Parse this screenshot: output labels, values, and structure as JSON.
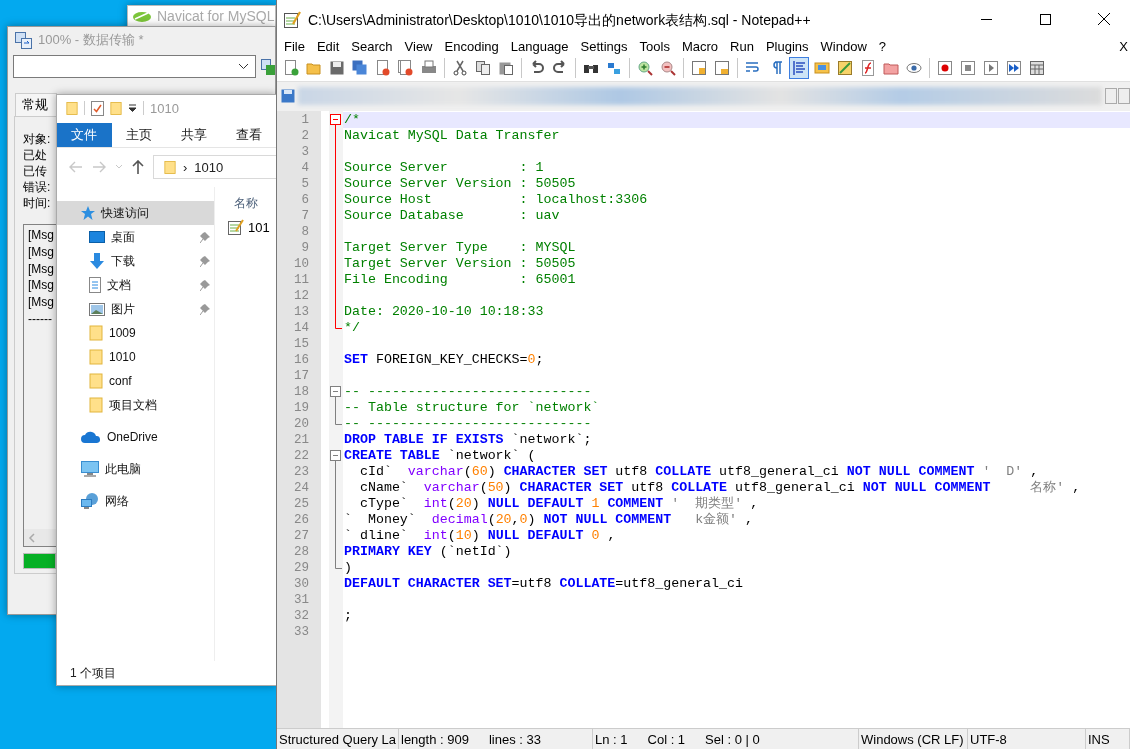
{
  "navicat_window": {
    "title": "Navicat for MySQL"
  },
  "transfer_window": {
    "title": "100% - 数据传输 *",
    "tab": "常规",
    "labels": [
      "对象:",
      "已处",
      "已传",
      "错误:",
      "时间:"
    ],
    "log": [
      "[Msg",
      "[Msg",
      "[Msg",
      "[Msg",
      "[Msg",
      "------"
    ],
    "progress": {
      "level": 1
    }
  },
  "explorer_window": {
    "title": "1010",
    "ribbon_tabs": [
      {
        "label": "文件",
        "selected": true
      },
      {
        "label": "主页",
        "selected": false
      },
      {
        "label": "共享",
        "selected": false
      },
      {
        "label": "查看",
        "selected": false
      }
    ],
    "address": {
      "separator": "›",
      "path": "1010"
    },
    "nav": [
      {
        "label": "快速访问",
        "kind": "star",
        "selected": true,
        "children": [
          {
            "label": "桌面",
            "kind": "desktop",
            "pinned": true
          },
          {
            "label": "下载",
            "kind": "download",
            "pinned": true
          },
          {
            "label": "文档",
            "kind": "document",
            "pinned": true
          },
          {
            "label": "图片",
            "kind": "image",
            "pinned": true
          },
          {
            "label": "1009",
            "kind": "folder",
            "pinned": false
          },
          {
            "label": "1010",
            "kind": "folder",
            "pinned": false
          },
          {
            "label": "conf",
            "kind": "folder",
            "pinned": false
          },
          {
            "label": "项目文档",
            "kind": "folder",
            "pinned": false
          }
        ]
      },
      {
        "label": "OneDrive",
        "kind": "cloud",
        "selected": false
      },
      {
        "label": "此电脑",
        "kind": "computer",
        "selected": false
      },
      {
        "label": "网络",
        "kind": "network",
        "selected": false
      }
    ],
    "column": "名称",
    "files": [
      {
        "name": "101"
      }
    ],
    "status": "1 个项目"
  },
  "notepad_window": {
    "title": "C:\\Users\\Administrator\\Desktop\\1010\\1010导出的network表结构.sql - Notepad++",
    "menu": [
      "File",
      "Edit",
      "Search",
      "View",
      "Encoding",
      "Language",
      "Settings",
      "Tools",
      "Macro",
      "Run",
      "Plugins",
      "Window",
      "?"
    ],
    "doc_close": "X",
    "toolbar": [
      [
        {
          "kind": "new",
          "pressed": false
        },
        {
          "kind": "open",
          "pressed": false
        },
        {
          "kind": "save",
          "pressed": false
        },
        {
          "kind": "saveall",
          "pressed": false
        },
        {
          "kind": "close",
          "pressed": false
        },
        {
          "kind": "closeall",
          "pressed": false
        },
        {
          "kind": "print",
          "pressed": false
        }
      ],
      [
        {
          "kind": "cut",
          "pressed": false
        },
        {
          "kind": "copy",
          "pressed": false
        },
        {
          "kind": "paste",
          "pressed": false
        }
      ],
      [
        {
          "kind": "undo",
          "pressed": false
        },
        {
          "kind": "redo",
          "pressed": false
        }
      ],
      [
        {
          "kind": "find",
          "pressed": false
        },
        {
          "kind": "replace",
          "pressed": false
        }
      ],
      [
        {
          "kind": "zoomin",
          "pressed": false
        },
        {
          "kind": "zoomout",
          "pressed": false
        }
      ],
      [
        {
          "kind": "syncv",
          "pressed": false
        },
        {
          "kind": "synch",
          "pressed": false
        }
      ],
      [
        {
          "kind": "wrap",
          "pressed": false
        },
        {
          "kind": "chars",
          "pressed": false
        },
        {
          "kind": "indent",
          "pressed": true
        },
        {
          "kind": "udl",
          "pressed": false
        },
        {
          "kind": "docmap",
          "pressed": false
        },
        {
          "kind": "funclist",
          "pressed": false
        },
        {
          "kind": "workspace",
          "pressed": false
        },
        {
          "kind": "monitor",
          "pressed": false
        }
      ],
      [
        {
          "kind": "record",
          "pressed": false
        },
        {
          "kind": "stop",
          "pressed": false
        },
        {
          "kind": "play",
          "pressed": false
        },
        {
          "kind": "playmulti",
          "pressed": false
        },
        {
          "kind": "savemacro",
          "pressed": false
        }
      ]
    ],
    "code_lines": [
      {
        "number": "1",
        "current": true,
        "fold_start": true,
        "fold_end": false,
        "tokens": [
          {
            "kind": "comment",
            "text": "/*"
          }
        ]
      },
      {
        "number": "2",
        "current": false,
        "fold_start": false,
        "fold_end": false,
        "tokens": [
          {
            "kind": "comment",
            "text": "Navicat MySQL Data Transfer"
          }
        ]
      },
      {
        "number": "3",
        "current": false,
        "fold_start": false,
        "fold_end": false
      },
      {
        "number": "4",
        "current": false,
        "fold_start": false,
        "fold_end": false,
        "tokens": [
          {
            "kind": "comment",
            "text": "Source Server         : 1"
          }
        ]
      },
      {
        "number": "5",
        "current": false,
        "fold_start": false,
        "fold_end": false,
        "tokens": [
          {
            "kind": "comment",
            "text": "Source Server Version : 50505"
          }
        ]
      },
      {
        "number": "6",
        "current": false,
        "fold_start": false,
        "fold_end": false,
        "tokens": [
          {
            "kind": "comment",
            "text": "Source Host           : localhost:3306"
          }
        ]
      },
      {
        "number": "7",
        "current": false,
        "fold_start": false,
        "fold_end": false,
        "tokens": [
          {
            "kind": "comment",
            "text": "Source Database       : uav"
          }
        ]
      },
      {
        "number": "8",
        "current": false,
        "fold_start": false,
        "fold_end": false
      },
      {
        "number": "9",
        "current": false,
        "fold_start": false,
        "fold_end": false,
        "tokens": [
          {
            "kind": "comment",
            "text": "Target Server Type    : MYSQL"
          }
        ]
      },
      {
        "number": "10",
        "current": false,
        "fold_start": false,
        "fold_end": false,
        "tokens": [
          {
            "kind": "comment",
            "text": "Target Server Version : 50505"
          }
        ]
      },
      {
        "number": "11",
        "current": false,
        "fold_start": false,
        "fold_end": false,
        "tokens": [
          {
            "kind": "comment",
            "text": "File Encoding         : 65001"
          }
        ]
      },
      {
        "number": "12",
        "current": false,
        "fold_start": false,
        "fold_end": false
      },
      {
        "number": "13",
        "current": false,
        "fold_start": false,
        "fold_end": false,
        "tokens": [
          {
            "kind": "comment",
            "text": "Date: 2020-10-10 10:18:33"
          }
        ]
      },
      {
        "number": "14",
        "current": false,
        "fold_start": false,
        "fold_end": true,
        "tokens": [
          {
            "kind": "comment",
            "text": "*/"
          }
        ]
      },
      {
        "number": "15",
        "current": false,
        "fold_start": false,
        "fold_end": false
      },
      {
        "number": "16",
        "current": false,
        "fold_start": false,
        "fold_end": false,
        "tokens": [
          {
            "kind": "keyword",
            "text": "SET"
          },
          {
            "kind": "plain",
            "text": " FOREIGN_KEY_CHECKS="
          },
          {
            "kind": "number",
            "text": "0"
          },
          {
            "kind": "plain",
            "text": ";"
          }
        ]
      },
      {
        "number": "17",
        "current": false,
        "fold_start": false,
        "fold_end": false
      },
      {
        "number": "18",
        "current": false,
        "fold_start": true,
        "fold_end": false,
        "tokens": [
          {
            "kind": "comment",
            "text": "-- ----------------------------"
          }
        ]
      },
      {
        "number": "19",
        "current": false,
        "fold_start": false,
        "fold_end": false,
        "tokens": [
          {
            "kind": "comment",
            "text": "-- Table structure for `network`"
          }
        ]
      },
      {
        "number": "20",
        "current": false,
        "fold_start": false,
        "fold_end": true,
        "tokens": [
          {
            "kind": "comment",
            "text": "-- ----------------------------"
          }
        ]
      },
      {
        "number": "21",
        "current": false,
        "fold_start": false,
        "fold_end": false,
        "tokens": [
          {
            "kind": "keyword",
            "text": "DROP TABLE IF EXISTS"
          },
          {
            "kind": "plain",
            "text": " `network`;"
          }
        ]
      },
      {
        "number": "22",
        "current": false,
        "fold_start": true,
        "fold_end": false,
        "tokens": [
          {
            "kind": "keyword",
            "text": "CREATE TABLE"
          },
          {
            "kind": "plain",
            "text": " `network` ("
          }
        ]
      },
      {
        "number": "23",
        "current": false,
        "fold_start": false,
        "fold_end": false,
        "tokens": [
          {
            "kind": "plain",
            "text": "  cId`  "
          },
          {
            "kind": "type",
            "text": "varchar"
          },
          {
            "kind": "plain",
            "text": "("
          },
          {
            "kind": "number",
            "text": "60"
          },
          {
            "kind": "plain",
            "text": ") "
          },
          {
            "kind": "keyword",
            "text": "CHARACTER SET"
          },
          {
            "kind": "plain",
            "text": " utf8 "
          },
          {
            "kind": "keyword",
            "text": "COLLATE"
          },
          {
            "kind": "plain",
            "text": " utf8_general_ci "
          },
          {
            "kind": "keyword",
            "text": "NOT NULL COMMENT"
          },
          {
            "kind": "string",
            "text": " '  D'"
          },
          {
            "kind": "plain",
            "text": " ,"
          }
        ]
      },
      {
        "number": "24",
        "current": false,
        "fold_start": false,
        "fold_end": false,
        "tokens": [
          {
            "kind": "plain",
            "text": "  cName`  "
          },
          {
            "kind": "type",
            "text": "varchar"
          },
          {
            "kind": "plain",
            "text": "("
          },
          {
            "kind": "number",
            "text": "50"
          },
          {
            "kind": "plain",
            "text": ") "
          },
          {
            "kind": "keyword",
            "text": "CHARACTER SET"
          },
          {
            "kind": "plain",
            "text": " utf8 "
          },
          {
            "kind": "keyword",
            "text": "COLLATE"
          },
          {
            "kind": "plain",
            "text": " utf8_general_ci "
          },
          {
            "kind": "keyword",
            "text": "NOT NULL COMMENT"
          },
          {
            "kind": "string",
            "text": "     名称'"
          },
          {
            "kind": "plain",
            "text": " ,"
          }
        ]
      },
      {
        "number": "25",
        "current": false,
        "fold_start": false,
        "fold_end": false,
        "tokens": [
          {
            "kind": "plain",
            "text": "  cType`  "
          },
          {
            "kind": "type",
            "text": "int"
          },
          {
            "kind": "plain",
            "text": "("
          },
          {
            "kind": "number",
            "text": "20"
          },
          {
            "kind": "plain",
            "text": ") "
          },
          {
            "kind": "keyword",
            "text": "NULL DEFAULT"
          },
          {
            "kind": "number",
            "text": " 1 "
          },
          {
            "kind": "keyword",
            "text": "COMMENT"
          },
          {
            "kind": "string",
            "text": " '  期类型'"
          },
          {
            "kind": "plain",
            "text": " ,"
          }
        ]
      },
      {
        "number": "26",
        "current": false,
        "fold_start": false,
        "fold_end": false,
        "tokens": [
          {
            "kind": "plain",
            "text": "`  Money`  "
          },
          {
            "kind": "type",
            "text": "decimal"
          },
          {
            "kind": "plain",
            "text": "("
          },
          {
            "kind": "number",
            "text": "20"
          },
          {
            "kind": "plain",
            "text": ","
          },
          {
            "kind": "number",
            "text": "0"
          },
          {
            "kind": "plain",
            "text": ") "
          },
          {
            "kind": "keyword",
            "text": "NOT NULL COMMENT"
          },
          {
            "kind": "string",
            "text": "   k金额'"
          },
          {
            "kind": "plain",
            "text": " ,"
          }
        ]
      },
      {
        "number": "27",
        "current": false,
        "fold_start": false,
        "fold_end": false,
        "tokens": [
          {
            "kind": "plain",
            "text": "` dline`  "
          },
          {
            "kind": "type",
            "text": "int"
          },
          {
            "kind": "plain",
            "text": "("
          },
          {
            "kind": "number",
            "text": "10"
          },
          {
            "kind": "plain",
            "text": ") "
          },
          {
            "kind": "keyword",
            "text": "NULL DEFAULT"
          },
          {
            "kind": "number",
            "text": " 0"
          },
          {
            "kind": "plain",
            "text": " ,"
          }
        ]
      },
      {
        "number": "28",
        "current": false,
        "fold_start": false,
        "fold_end": false,
        "tokens": [
          {
            "kind": "keyword",
            "text": "PRIMARY KEY"
          },
          {
            "kind": "plain",
            "text": " (`netId`)"
          }
        ]
      },
      {
        "number": "29",
        "current": false,
        "fold_start": false,
        "fold_end": true,
        "tokens": [
          {
            "kind": "plain",
            "text": ")"
          }
        ]
      },
      {
        "number": "30",
        "current": false,
        "fold_start": false,
        "fold_end": false,
        "tokens": [
          {
            "kind": "keyword",
            "text": "DEFAULT CHARACTER SET"
          },
          {
            "kind": "plain",
            "text": "=utf8 "
          },
          {
            "kind": "keyword",
            "text": "COLLATE"
          },
          {
            "kind": "plain",
            "text": "=utf8_general_ci"
          }
        ]
      },
      {
        "number": "31",
        "current": false,
        "fold_start": false,
        "fold_end": false
      },
      {
        "number": "32",
        "current": false,
        "fold_start": false,
        "fold_end": false,
        "tokens": [
          {
            "kind": "plain",
            "text": ";"
          }
        ]
      },
      {
        "number": "33",
        "current": false,
        "fold_start": false,
        "fold_end": false
      }
    ],
    "status_bar": [
      {
        "texts": [
          "Structured Query La"
        ]
      },
      {
        "texts": [
          "length : 909",
          "lines : 33"
        ]
      },
      {
        "texts": [
          "Ln : 1",
          "Col : 1",
          "Sel : 0 | 0"
        ]
      },
      {
        "texts": [
          "Windows (CR LF)"
        ]
      },
      {
        "texts": [
          "UTF-8"
        ]
      },
      {
        "texts": [
          "INS"
        ]
      }
    ]
  }
}
